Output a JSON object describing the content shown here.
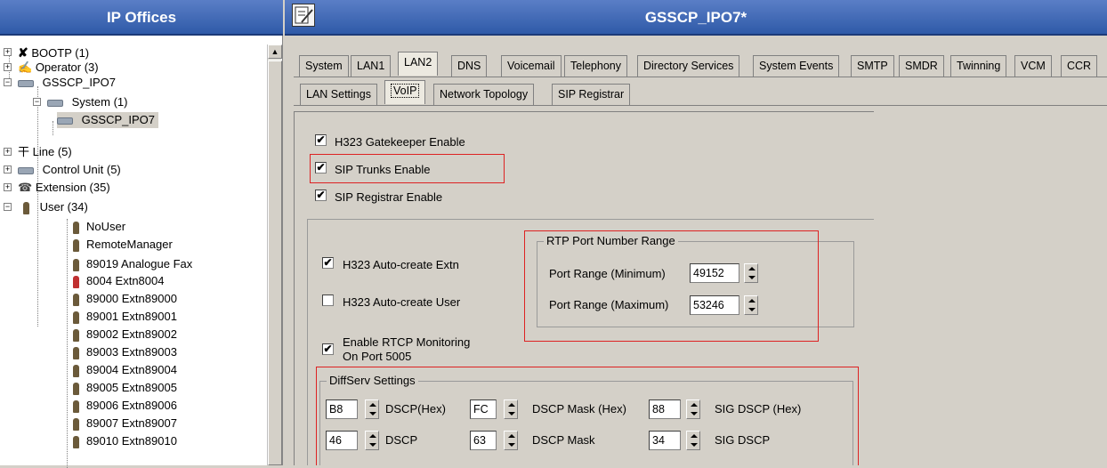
{
  "left_title": "IP Offices",
  "tree": [
    {
      "label": "BOOTP (1)"
    },
    {
      "label": "Operator (3)"
    },
    {
      "label": "GSSCP_IPO7"
    },
    {
      "label": "System (1)"
    },
    {
      "label": "GSSCP_IPO7"
    },
    {
      "label": "Line (5)"
    },
    {
      "label": "Control Unit (5)"
    },
    {
      "label": "Extension (35)"
    },
    {
      "label": "User (34)"
    },
    {
      "label": "NoUser"
    },
    {
      "label": "RemoteManager"
    },
    {
      "label": "89019 Analogue Fax"
    },
    {
      "label": "8004 Extn8004"
    },
    {
      "label": "89000 Extn89000"
    },
    {
      "label": "89001 Extn89001"
    },
    {
      "label": "89002 Extn89002"
    },
    {
      "label": "89003 Extn89003"
    },
    {
      "label": "89004 Extn89004"
    },
    {
      "label": "89005 Extn89005"
    },
    {
      "label": "89006 Extn89006"
    },
    {
      "label": "89007 Extn89007"
    },
    {
      "label": "89010 Extn89010"
    }
  ],
  "right_title": "GSSCP_IPO7*",
  "tabs": [
    "System",
    "LAN1",
    "LAN2",
    "DNS",
    "Voicemail",
    "Telephony",
    "Directory Services",
    "System Events",
    "SMTP",
    "SMDR",
    "Twinning",
    "VCM",
    "CCR"
  ],
  "subtabs": [
    "LAN Settings",
    "VoIP",
    "Network Topology",
    "SIP Registrar"
  ],
  "checks": {
    "h323_gk": "H323 Gatekeeper Enable",
    "sip_trunks": "SIP Trunks Enable",
    "sip_registrar": "SIP Registrar Enable",
    "auto_extn": "H323 Auto-create Extn",
    "auto_user": "H323 Auto-create User",
    "rtcp_1": "Enable RTCP Monitoring",
    "rtcp_2": "On Port 5005",
    "check_mark": "✔"
  },
  "rtp": {
    "title": "RTP Port Number Range",
    "min_label": "Port Range (Minimum)",
    "min_value": "49152",
    "max_label": "Port Range (Maximum)",
    "max_value": "53246"
  },
  "diffserv": {
    "title": "DiffServ Settings",
    "r1": {
      "v1": "B8",
      "l1": "DSCP(Hex)",
      "v2": "FC",
      "l2": "DSCP Mask (Hex)",
      "v3": "88",
      "l3": "SIG DSCP (Hex)"
    },
    "r2": {
      "v1": "46",
      "l1": "DSCP",
      "v2": "63",
      "l2": "DSCP Mask",
      "v3": "34",
      "l3": "SIG DSCP"
    }
  },
  "colors": {
    "title_bar": "#2f5aa8",
    "highlight": "#dd2222"
  }
}
